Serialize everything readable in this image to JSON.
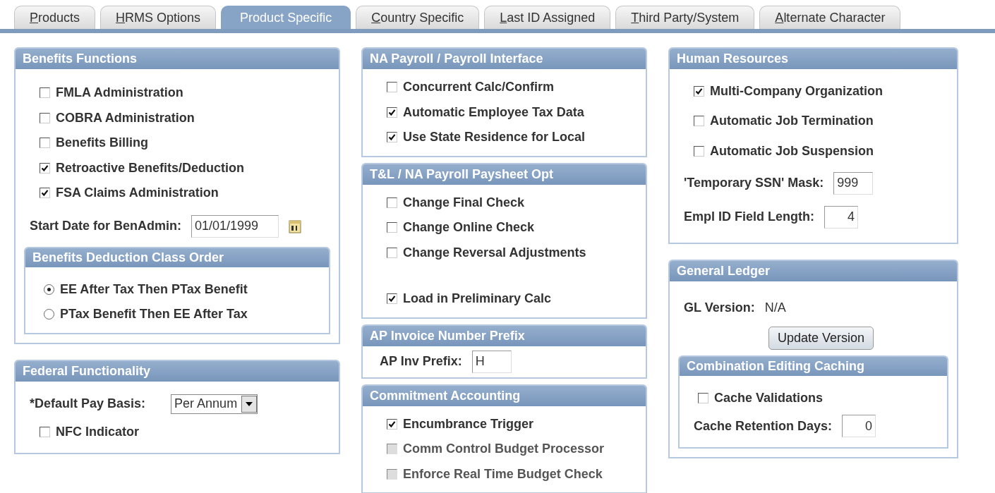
{
  "tabs": [
    {
      "label": "Products",
      "selected": false,
      "underline_first": true
    },
    {
      "label": "HRMS Options",
      "selected": false,
      "underline_first": true
    },
    {
      "label": "Product Specific",
      "selected": true,
      "underline_first": false
    },
    {
      "label": "Country Specific",
      "selected": false,
      "underline_first": true
    },
    {
      "label": "Last ID Assigned",
      "selected": false,
      "underline_first": true
    },
    {
      "label": "Third Party/System",
      "selected": false,
      "underline_first": true
    },
    {
      "label": "Alternate Character",
      "selected": false,
      "underline_first": true
    }
  ],
  "columns": [
    [
      {
        "title": "Benefits Functions",
        "items": [
          {
            "kind": "checkbox",
            "label": "FMLA Administration",
            "checked": false,
            "disabled": false
          },
          {
            "kind": "checkbox",
            "label": "COBRA Administration",
            "checked": false,
            "disabled": false
          },
          {
            "kind": "checkbox",
            "label": "Benefits Billing",
            "checked": false,
            "disabled": false
          },
          {
            "kind": "checkbox",
            "label": "Retroactive Benefits/Deduction",
            "checked": true,
            "disabled": false
          },
          {
            "kind": "checkbox",
            "label": "FSA Claims Administration",
            "checked": true,
            "disabled": false
          },
          {
            "kind": "date_field",
            "label": "Start Date for BenAdmin:",
            "value": "01/01/1999"
          },
          {
            "kind": "group",
            "title": "Benefits Deduction Class Order",
            "items": [
              {
                "kind": "radio",
                "label": "EE After Tax Then PTax Benefit",
                "selected": true
              },
              {
                "kind": "radio",
                "label": "PTax Benefit Then EE After Tax",
                "selected": false
              }
            ]
          }
        ]
      },
      {
        "title": "Federal Functionality",
        "items": [
          {
            "kind": "dropdown",
            "label": "*Default Pay Basis:",
            "value": "Per Annum"
          },
          {
            "kind": "checkbox",
            "label": "NFC Indicator",
            "checked": false,
            "disabled": false
          }
        ]
      }
    ],
    [
      {
        "title": "NA Payroll / Payroll Interface",
        "items": [
          {
            "kind": "checkbox",
            "label": "Concurrent Calc/Confirm",
            "checked": false,
            "disabled": false
          },
          {
            "kind": "checkbox",
            "label": "Automatic Employee Tax Data",
            "checked": true,
            "disabled": false
          },
          {
            "kind": "checkbox",
            "label": "Use State Residence for Local",
            "checked": true,
            "disabled": false
          }
        ]
      },
      {
        "title": "T&L / NA Payroll Paysheet Opt",
        "items": [
          {
            "kind": "checkbox",
            "label": "Change Final Check",
            "checked": false,
            "disabled": false
          },
          {
            "kind": "checkbox",
            "label": "Change Online Check",
            "checked": false,
            "disabled": false
          },
          {
            "kind": "checkbox",
            "label": "Change Reversal Adjustments",
            "checked": false,
            "disabled": false
          },
          {
            "kind": "spacer"
          },
          {
            "kind": "checkbox",
            "label": "Load in Preliminary Calc",
            "checked": true,
            "disabled": false
          }
        ]
      },
      {
        "title": "AP Invoice Number Prefix",
        "items": [
          {
            "kind": "field",
            "label": "AP Inv Prefix:",
            "value": "H"
          }
        ]
      },
      {
        "title": "Commitment Accounting",
        "items": [
          {
            "kind": "checkbox",
            "label": "Encumbrance Trigger",
            "checked": true,
            "disabled": false
          },
          {
            "kind": "checkbox",
            "label": "Comm Control Budget Processor",
            "checked": false,
            "disabled": true
          },
          {
            "kind": "checkbox",
            "label": "Enforce Real Time Budget Check",
            "checked": false,
            "disabled": true
          }
        ]
      }
    ],
    [
      {
        "title": "Human Resources",
        "items": [
          {
            "kind": "checkbox",
            "label": "Multi-Company Organization",
            "checked": true,
            "disabled": false
          },
          {
            "kind": "checkbox",
            "label": "Automatic Job Termination",
            "checked": false,
            "disabled": false
          },
          {
            "kind": "checkbox",
            "label": "Automatic Job Suspension",
            "checked": false,
            "disabled": false
          },
          {
            "kind": "field",
            "label": "'Temporary SSN' Mask:",
            "value": "999"
          },
          {
            "kind": "number_field",
            "label": "Empl ID Field Length:",
            "value": "4"
          }
        ]
      },
      {
        "title": "General Ledger",
        "items": [
          {
            "kind": "readout",
            "label": "GL Version:",
            "value": "N/A"
          },
          {
            "kind": "button",
            "label": "Update Version"
          },
          {
            "kind": "group",
            "title": "Combination Editing Caching",
            "items": [
              {
                "kind": "checkbox",
                "label": "Cache Validations",
                "checked": false,
                "disabled": false
              },
              {
                "kind": "number_field",
                "label": "Cache Retention Days:",
                "value": "0"
              }
            ]
          }
        ]
      }
    ]
  ]
}
